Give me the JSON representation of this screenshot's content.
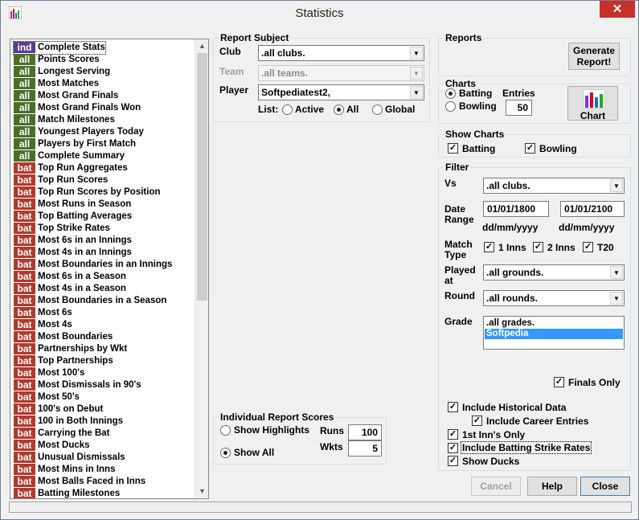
{
  "window": {
    "title": "Statistics",
    "close_glyph": "✕"
  },
  "report_list": {
    "items": [
      {
        "badge": "ind",
        "label": "Complete Stats",
        "color": "#5b3c91"
      },
      {
        "badge": "all",
        "label": "Points Scores",
        "color": "#4a6f2a"
      },
      {
        "badge": "all",
        "label": "Longest Serving",
        "color": "#4a6f2a"
      },
      {
        "badge": "all",
        "label": "Most Matches",
        "color": "#4a6f2a"
      },
      {
        "badge": "all",
        "label": "Most Grand Finals",
        "color": "#4a6f2a"
      },
      {
        "badge": "all",
        "label": "Most Grand Finals Won",
        "color": "#4a6f2a"
      },
      {
        "badge": "all",
        "label": "Match Milestones",
        "color": "#4a6f2a"
      },
      {
        "badge": "all",
        "label": "Youngest Players Today",
        "color": "#4a6f2a"
      },
      {
        "badge": "all",
        "label": "Players by First Match",
        "color": "#4a6f2a"
      },
      {
        "badge": "all",
        "label": "Complete Summary",
        "color": "#4a6f2a"
      },
      {
        "badge": "bat",
        "label": "Top Run Aggregates",
        "color": "#b03a2e"
      },
      {
        "badge": "bat",
        "label": "Top Run Scores",
        "color": "#b03a2e"
      },
      {
        "badge": "bat",
        "label": "Top Run Scores by Position",
        "color": "#b03a2e"
      },
      {
        "badge": "bat",
        "label": "Most Runs in Season",
        "color": "#b03a2e"
      },
      {
        "badge": "bat",
        "label": "Top Batting Averages",
        "color": "#b03a2e"
      },
      {
        "badge": "bat",
        "label": "Top Strike Rates",
        "color": "#b03a2e"
      },
      {
        "badge": "bat",
        "label": "Most 6s in an Innings",
        "color": "#b03a2e"
      },
      {
        "badge": "bat",
        "label": "Most 4s in an Innings",
        "color": "#b03a2e"
      },
      {
        "badge": "bat",
        "label": "Most Boundaries in an Innings",
        "color": "#b03a2e"
      },
      {
        "badge": "bat",
        "label": "Most 6s in a Season",
        "color": "#b03a2e"
      },
      {
        "badge": "bat",
        "label": "Most 4s in a Season",
        "color": "#b03a2e"
      },
      {
        "badge": "bat",
        "label": "Most Boundaries in a Season",
        "color": "#b03a2e"
      },
      {
        "badge": "bat",
        "label": "Most 6s",
        "color": "#b03a2e"
      },
      {
        "badge": "bat",
        "label": "Most 4s",
        "color": "#b03a2e"
      },
      {
        "badge": "bat",
        "label": "Most Boundaries",
        "color": "#b03a2e"
      },
      {
        "badge": "bat",
        "label": "Partnerships by Wkt",
        "color": "#b03a2e"
      },
      {
        "badge": "bat",
        "label": "Top Partnerships",
        "color": "#b03a2e"
      },
      {
        "badge": "bat",
        "label": "Most 100's",
        "color": "#b03a2e"
      },
      {
        "badge": "bat",
        "label": "Most Dismissals in 90's",
        "color": "#b03a2e"
      },
      {
        "badge": "bat",
        "label": "Most 50's",
        "color": "#b03a2e"
      },
      {
        "badge": "bat",
        "label": "100's on Debut",
        "color": "#b03a2e"
      },
      {
        "badge": "bat",
        "label": "100 in Both Innings",
        "color": "#b03a2e"
      },
      {
        "badge": "bat",
        "label": "Carrying the Bat",
        "color": "#b03a2e"
      },
      {
        "badge": "bat",
        "label": "Most Ducks",
        "color": "#b03a2e"
      },
      {
        "badge": "bat",
        "label": "Unusual Dismissals",
        "color": "#b03a2e"
      },
      {
        "badge": "bat",
        "label": "Most Mins in Inns",
        "color": "#b03a2e"
      },
      {
        "badge": "bat",
        "label": "Most Balls Faced in Inns",
        "color": "#b03a2e"
      },
      {
        "badge": "bat",
        "label": "Batting Milestones",
        "color": "#b03a2e"
      }
    ]
  },
  "report_subject": {
    "legend": "Report Subject",
    "club_label": "Club",
    "club_value": ".all clubs.",
    "team_label": "Team",
    "team_value": ".all teams.",
    "player_label": "Player",
    "player_value": "Softpediatest2,",
    "list_label": "List:",
    "list_active": "Active",
    "list_all": "All",
    "list_global": "Global"
  },
  "individual_scores": {
    "legend": "Individual Report Scores",
    "show_highlights": "Show Highlights",
    "show_all": "Show All",
    "runs_label": "Runs",
    "runs_value": "100",
    "wkts_label": "Wkts",
    "wkts_value": "5"
  },
  "reports": {
    "legend": "Reports",
    "generate_label": "Generate Report!"
  },
  "charts": {
    "legend": "Charts",
    "entries_label": "Entries",
    "entries_value": "50",
    "batting": "Batting",
    "bowling": "Bowling",
    "chart_button": "Chart"
  },
  "show_charts": {
    "legend": "Show Charts",
    "batting": "Batting",
    "bowling": "Bowling"
  },
  "filter": {
    "legend": "Filter",
    "vs_label": "Vs",
    "vs_value": ".all clubs.",
    "date_label_1": "Date",
    "date_label_2": "Range",
    "date_from": "01/01/1800",
    "date_to": "01/01/2100",
    "date_hint_from": "dd/mm/yyyy",
    "date_hint_to": "dd/mm/yyyy",
    "match_type_1": "Match",
    "match_type_2": "Type",
    "inns1": "1 Inns",
    "inns2": "2 Inns",
    "t20": "T20",
    "played_at_1": "Played",
    "played_at_2": "at",
    "played_at_value": ".all grounds.",
    "round_label": "Round",
    "round_value": ".all rounds.",
    "grade_label": "Grade",
    "grade_options": [
      ".all grades.",
      "Softpedia"
    ],
    "finals_only": "Finals Only"
  },
  "options": {
    "include_historical": "Include Historical Data",
    "include_career": "Include Career Entries",
    "first_inn_only": "1st Inn's Only",
    "include_strike_rates": "Include Batting Strike Rates",
    "show_ducks": "Show Ducks"
  },
  "footer": {
    "cancel": "Cancel",
    "help": "Help",
    "close": "Close"
  }
}
